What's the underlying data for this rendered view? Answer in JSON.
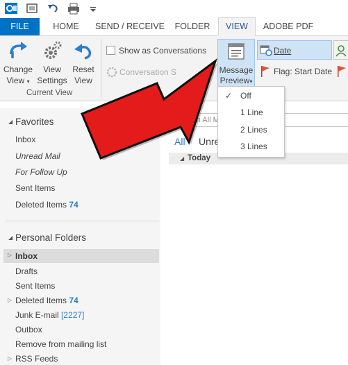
{
  "quick_access": {
    "icons": [
      "outlook-icon",
      "send-receive-all-icon",
      "undo-icon",
      "print-icon",
      "customize-qat-icon"
    ]
  },
  "tabs": [
    {
      "label": "FILE"
    },
    {
      "label": "HOME"
    },
    {
      "label": "SEND / RECEIVE"
    },
    {
      "label": "FOLDER"
    },
    {
      "label": "VIEW"
    },
    {
      "label": "ADOBE PDF"
    }
  ],
  "ribbon": {
    "change_view": {
      "line1": "Change",
      "line2": "View"
    },
    "view_settings": {
      "line1": "View",
      "line2": "Settings"
    },
    "reset_view": {
      "line1": "Reset",
      "line2": "View"
    },
    "current_view_group": "Current View",
    "show_as_conversations": "Show as Conversations",
    "conversation_settings": "Conversation S",
    "group2_partial": "M",
    "message_preview": {
      "line1": "Message",
      "line2": "Preview"
    },
    "date": "Date",
    "flag_start_date": "Flag: Start Date"
  },
  "dropdown": {
    "items": [
      {
        "label": "Off",
        "checked": true
      },
      {
        "label": "1 Line",
        "checked": false
      },
      {
        "label": "2 Lines",
        "checked": false
      },
      {
        "label": "3 Lines",
        "checked": false
      }
    ]
  },
  "nav": {
    "favorites_header": "Favorites",
    "favorites": [
      {
        "label": "Inbox",
        "italic": false
      },
      {
        "label": "Unread Mail",
        "italic": true
      },
      {
        "label": "For Follow Up",
        "italic": true
      },
      {
        "label": "Sent Items",
        "italic": false
      },
      {
        "label": "Deleted Items",
        "italic": false,
        "count": "74"
      }
    ],
    "personal_header": "Personal Folders",
    "folders": [
      {
        "label": "Inbox",
        "bold": true
      },
      {
        "label": "Drafts"
      },
      {
        "label": "Sent Items"
      },
      {
        "label": "Deleted Items",
        "count": "74"
      },
      {
        "label": "Junk E-mail",
        "count": "[2227]"
      },
      {
        "label": "Outbox"
      },
      {
        "label": "Remove from mailing list"
      },
      {
        "label": "RSS Feeds"
      }
    ]
  },
  "list": {
    "search_placeholder": "Search All M",
    "filter_all": "All",
    "filter_unread": "Unre",
    "group_today": "Today"
  },
  "colors": {
    "accent": "#0072c6",
    "link": "#2b7cd3",
    "arrow": "#e31b1b"
  }
}
